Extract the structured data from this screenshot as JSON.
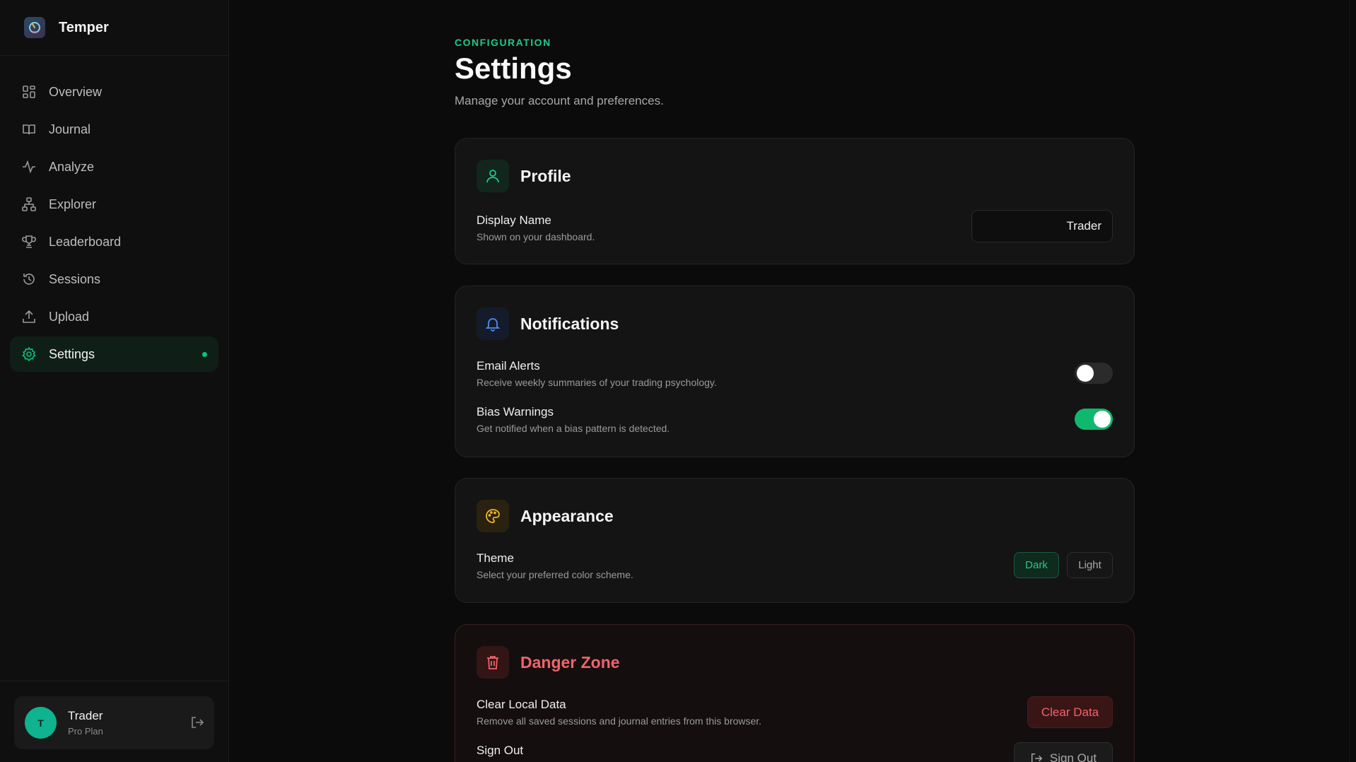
{
  "brand": {
    "name": "Temper"
  },
  "nav": [
    {
      "label": "Overview",
      "icon": "grid-icon"
    },
    {
      "label": "Journal",
      "icon": "book-icon"
    },
    {
      "label": "Analyze",
      "icon": "activity-icon"
    },
    {
      "label": "Explorer",
      "icon": "network-icon"
    },
    {
      "label": "Leaderboard",
      "icon": "trophy-icon"
    },
    {
      "label": "Sessions",
      "icon": "history-icon"
    },
    {
      "label": "Upload",
      "icon": "upload-icon"
    },
    {
      "label": "Settings",
      "icon": "gear-icon",
      "active": true
    }
  ],
  "user": {
    "initial": "T",
    "name": "Trader",
    "plan": "Pro Plan"
  },
  "header": {
    "eyebrow": "CONFIGURATION",
    "title": "Settings",
    "subtitle": "Manage your account and preferences."
  },
  "profile": {
    "title": "Profile",
    "display_name_label": "Display Name",
    "display_name_desc": "Shown on your dashboard.",
    "display_name_value": "Trader"
  },
  "notifications": {
    "title": "Notifications",
    "email_label": "Email Alerts",
    "email_desc": "Receive weekly summaries of your trading psychology.",
    "email_enabled": false,
    "bias_label": "Bias Warnings",
    "bias_desc": "Get notified when a bias pattern is detected.",
    "bias_enabled": true
  },
  "appearance": {
    "title": "Appearance",
    "theme_label": "Theme",
    "theme_desc": "Select your preferred color scheme.",
    "dark_label": "Dark",
    "light_label": "Light",
    "selected": "Dark"
  },
  "danger": {
    "title": "Danger Zone",
    "clear_label": "Clear Local Data",
    "clear_desc": "Remove all saved sessions and journal entries from this browser.",
    "clear_button": "Clear Data",
    "signout_label": "Sign Out",
    "signout_button": "Sign Out"
  },
  "colors": {
    "accent": "#10c07a",
    "danger": "#f0646a",
    "background": "#0b0b0b"
  }
}
